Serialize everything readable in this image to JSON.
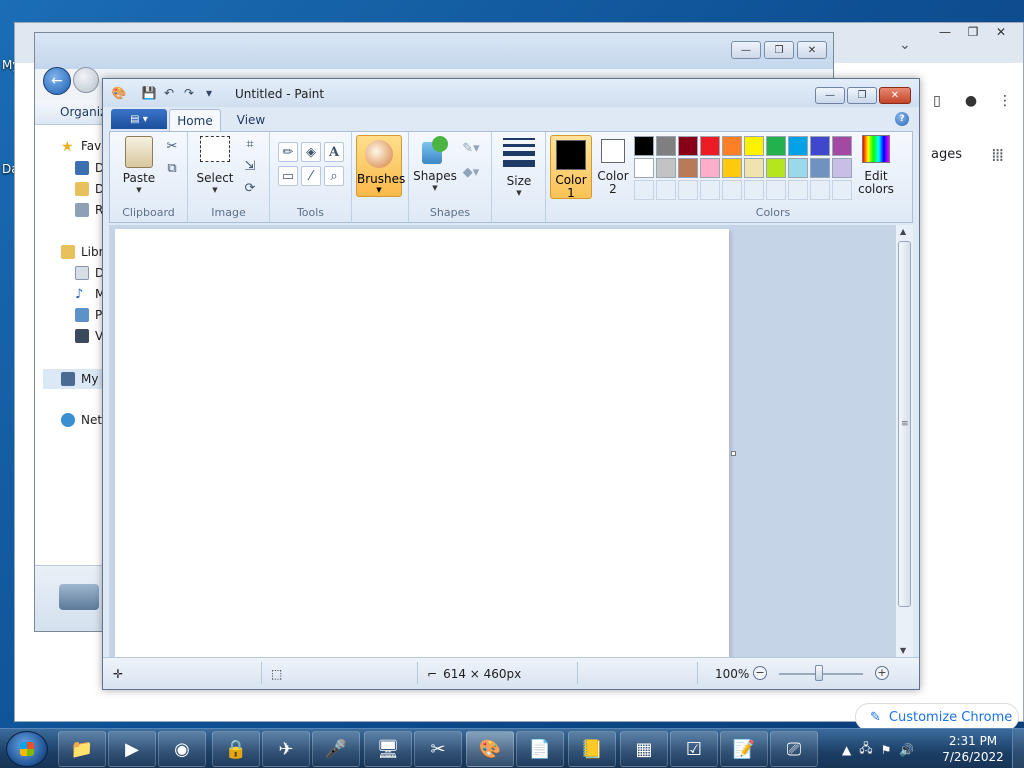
{
  "desktop": {
    "label_left1": "My",
    "label_left2": "Da"
  },
  "chrome": {
    "images_link": "ages",
    "customize_label": "Customize Chrome"
  },
  "explorer": {
    "organize_label": "Organiz",
    "sidebar": [
      {
        "label": "Fav",
        "top": 0
      },
      {
        "label": "D"
      },
      {
        "label": "D"
      },
      {
        "label": "R"
      },
      {
        "label": "Libr"
      },
      {
        "label": "D"
      },
      {
        "label": "M"
      },
      {
        "label": "Pi"
      },
      {
        "label": "Vi"
      },
      {
        "label": "My"
      },
      {
        "label": "Net"
      }
    ]
  },
  "paint": {
    "title": "Untitled - Paint",
    "tabs": {
      "home": "Home",
      "view": "View"
    },
    "groups": {
      "clipboard": "Clipboard",
      "image": "Image",
      "tools": "Tools",
      "shapes": "Shapes",
      "colors": "Colors"
    },
    "buttons": {
      "paste": "Paste",
      "select": "Select",
      "brushes": "Brushes",
      "shapes": "Shapes",
      "size": "Size",
      "color1_line1": "Color",
      "color1_line2": "1",
      "color2_line1": "Color",
      "color2_line2": "2",
      "edit_colors_line1": "Edit",
      "edit_colors_line2": "colors"
    },
    "palette_row1": [
      "#000000",
      "#7f7f7f",
      "#880015",
      "#ed1c24",
      "#ff7f27",
      "#fff200",
      "#22b14c",
      "#00a2e8",
      "#3f48cc",
      "#a349a4"
    ],
    "palette_row2": [
      "#ffffff",
      "#c3c3c3",
      "#b97a57",
      "#ffaec9",
      "#ffc90e",
      "#efe4b0",
      "#b5e61d",
      "#99d9ea",
      "#7092be",
      "#c8bfe7"
    ],
    "color1": "#000000",
    "color2": "#ffffff",
    "status": {
      "dimensions": "614 × 460px",
      "zoom": "100%"
    }
  },
  "taskbar": {
    "time": "2:31 PM",
    "date": "7/26/2022"
  }
}
